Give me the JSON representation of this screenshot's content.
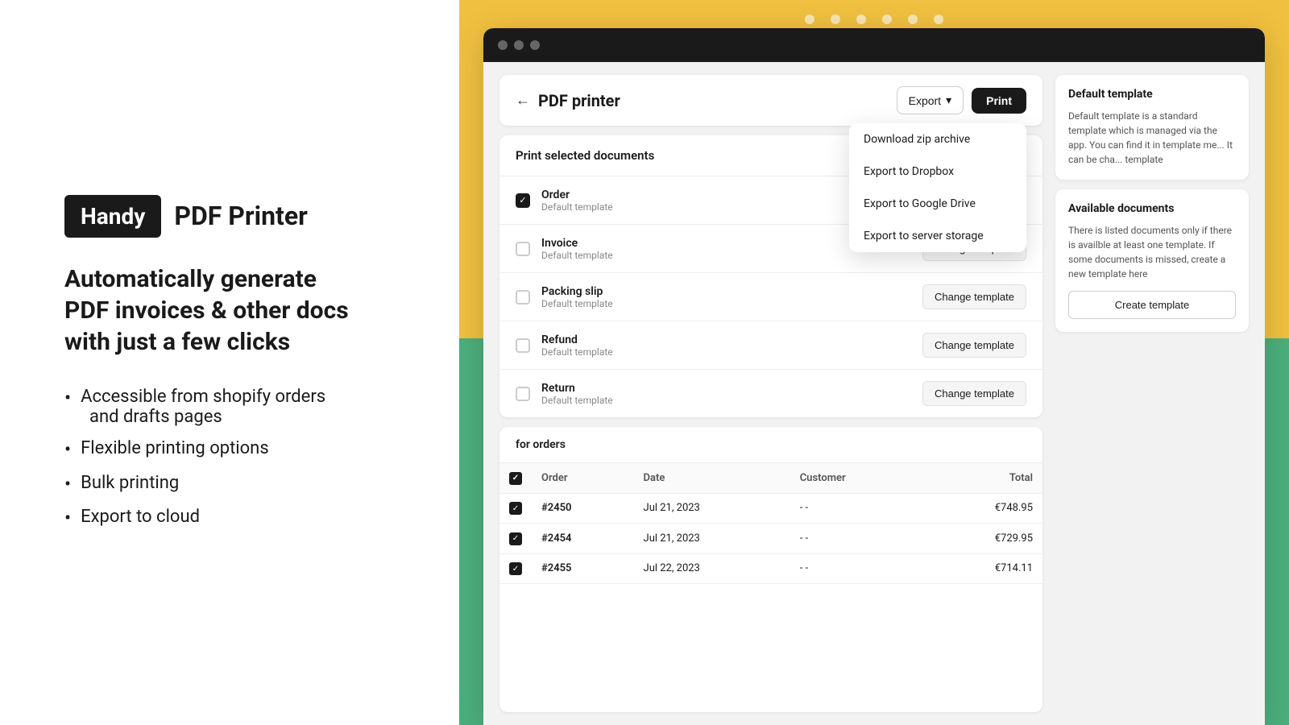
{
  "left": {
    "logo_label": "Handy",
    "app_name": "PDF Printer",
    "tagline": "Automatically generate\nPDF invoices & other docs\nwith just a few clicks",
    "features": [
      "Accessible from shopify orders\nand drafts pages",
      "Flexible printing options",
      "Bulk printing",
      "Export to cloud"
    ]
  },
  "header": {
    "back_label": "←",
    "title": "PDF printer",
    "export_label": "Export",
    "export_chevron": "▾",
    "print_label": "Print"
  },
  "documents_section": {
    "title": "Print selected documents",
    "rows": [
      {
        "name": "Order",
        "template": "Default template",
        "checked": true
      },
      {
        "name": "Invoice",
        "template": "Default template",
        "checked": false
      },
      {
        "name": "Packing slip",
        "template": "Default template",
        "checked": false
      },
      {
        "name": "Refund",
        "template": "Default template",
        "checked": false
      },
      {
        "name": "Return",
        "template": "Default template",
        "checked": false
      }
    ],
    "change_template_label": "Change template"
  },
  "orders_section": {
    "title": "for orders",
    "columns": [
      "Order",
      "Date",
      "Customer",
      "Total"
    ],
    "rows": [
      {
        "order": "#2450",
        "date": "Jul 21, 2023",
        "customer": "- -",
        "total": "€748.95",
        "checked": true
      },
      {
        "order": "#2454",
        "date": "Jul 21, 2023",
        "customer": "- -",
        "total": "€729.95",
        "checked": true
      },
      {
        "order": "#2455",
        "date": "Jul 22, 2023",
        "customer": "- -",
        "total": "€714.11",
        "checked": true
      }
    ]
  },
  "sidebar": {
    "default_template": {
      "title": "Default template",
      "description": "Default template is a standard template which is managed via the app. You can find it in template me... It can be cha... template"
    },
    "available_docs": {
      "title": "Available documents",
      "description": "There is listed documents only if there is availble at least one template. If some documents is missed, create a new template here"
    },
    "create_template_label": "Create template"
  },
  "dropdown": {
    "items": [
      "Download zip archive",
      "Export to Dropbox",
      "Export to Google Drive",
      "Export to server storage"
    ]
  },
  "titlebar_dots": [
    "•",
    "•",
    "•"
  ],
  "decorative_dots": [
    1,
    2,
    3,
    4,
    5,
    6
  ]
}
